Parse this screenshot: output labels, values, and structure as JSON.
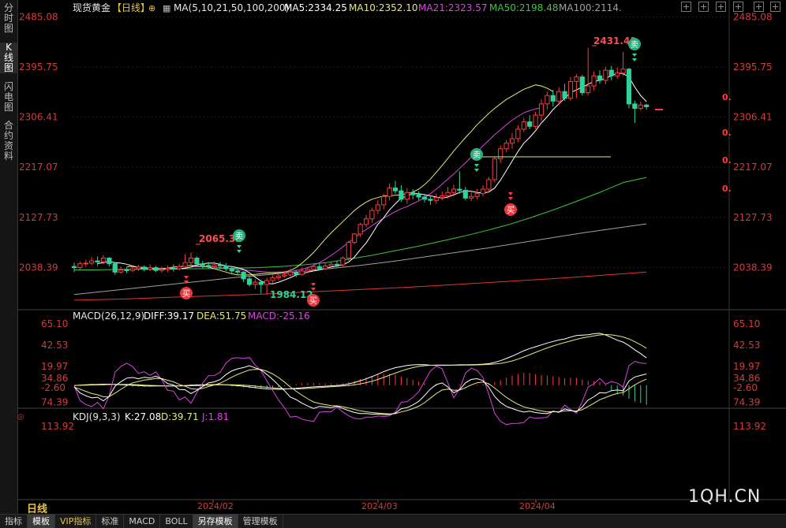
{
  "sidebar": {
    "tabs": [
      "分时图",
      "K线图",
      "闪电图",
      "合约资料"
    ],
    "active_index": 1
  },
  "header": {
    "name": "现货黄金",
    "period": "【日线】",
    "ma_label": "MA(5,10,21,50,100,200)",
    "ma5": "MA5:2334.25",
    "ma10": "MA10:2352.10",
    "ma21": "MA21:2323.57",
    "ma50": "MA50:2198.48",
    "ma100": "MA100:2114."
  },
  "macd_header": {
    "name": "MACD(26,12,9)",
    "diff": "DIFF:39.17",
    "dea": "DEA:51.75",
    "macd": "MACD:-25.16"
  },
  "kdj_header": {
    "name": "KDJ(9,3,3)",
    "k": "K:27.08",
    "d": "D:39.71",
    "j": "J:1.81"
  },
  "price_axis": [
    "2485.08",
    "2395.75",
    "2306.41",
    "2217.07",
    "2127.73",
    "2038.39"
  ],
  "macd_axis": [
    "65.10",
    "42.53",
    "19.97",
    "-2.60"
  ],
  "kdj_axis": [
    "113.92",
    "74.39",
    "34.86"
  ],
  "x_axis": [
    "2024/02",
    "2024/03",
    "2024/04"
  ],
  "annotations": {
    "high1": "2065.32",
    "low1": "1984.12",
    "high2": "2431.41",
    "buy": "买",
    "sell": "卖",
    "right_marks": [
      "0.",
      "0.",
      "0.",
      "0."
    ]
  },
  "bottom": {
    "period_button": "日线",
    "tabs": [
      "指标",
      "模板",
      "VIP指标",
      "标准",
      "MACD",
      "BOLL",
      "另存模板",
      "管理模板"
    ]
  },
  "watermark": "1QH.CN",
  "colors": {
    "up": "#ff3b3b",
    "down": "#2dd39a",
    "ma5": "#ffffff",
    "ma10": "#e8e87a",
    "ma21": "#d845e0",
    "ma50": "#3ec43e",
    "ma100": "#a0a0a0",
    "ma200": "#e03a2a"
  },
  "chart_data": {
    "type": "candlestick",
    "ylim": [
      1970,
      2490
    ],
    "candles": [
      [
        2040,
        2038,
        2047,
        2030
      ],
      [
        2038,
        2045,
        2049,
        2033
      ],
      [
        2045,
        2046,
        2052,
        2040
      ],
      [
        2046,
        2050,
        2057,
        2042
      ],
      [
        2050,
        2048,
        2058,
        2041
      ],
      [
        2048,
        2055,
        2060,
        2044
      ],
      [
        2055,
        2045,
        2057,
        2040
      ],
      [
        2045,
        2030,
        2047,
        2025
      ],
      [
        2030,
        2034,
        2040,
        2027
      ],
      [
        2034,
        2033,
        2039,
        2028
      ],
      [
        2033,
        2036,
        2041,
        2030
      ],
      [
        2036,
        2039,
        2043,
        2032
      ],
      [
        2039,
        2035,
        2042,
        2031
      ],
      [
        2035,
        2038,
        2044,
        2032
      ],
      [
        2038,
        2033,
        2041,
        2030
      ],
      [
        2033,
        2035,
        2040,
        2029
      ],
      [
        2035,
        2037,
        2042,
        2030
      ],
      [
        2037,
        2036,
        2044,
        2031
      ],
      [
        2036,
        2040,
        2045,
        2033
      ],
      [
        2040,
        2047,
        2062,
        2038
      ],
      [
        2047,
        2055,
        2065,
        2043
      ],
      [
        2055,
        2045,
        2058,
        2040
      ],
      [
        2045,
        2042,
        2050,
        2037
      ],
      [
        2042,
        2040,
        2048,
        2036
      ],
      [
        2040,
        2043,
        2049,
        2037
      ],
      [
        2043,
        2041,
        2048,
        2035
      ],
      [
        2041,
        2036,
        2046,
        2032
      ],
      [
        2036,
        2032,
        2041,
        2028
      ],
      [
        2032,
        2030,
        2038,
        2025
      ],
      [
        2030,
        2018,
        2032,
        2012
      ],
      [
        2018,
        2008,
        2022,
        2004
      ],
      [
        2008,
        2012,
        2017,
        2000
      ],
      [
        2012,
        2008,
        2016,
        1992
      ],
      [
        2008,
        2015,
        2020,
        1990
      ],
      [
        2015,
        2020,
        2025,
        2010
      ],
      [
        2020,
        2023,
        2028,
        2015
      ],
      [
        2023,
        2025,
        2032,
        2020
      ],
      [
        2025,
        2030,
        2036,
        2022
      ],
      [
        2030,
        2026,
        2034,
        2021
      ],
      [
        2026,
        2032,
        2038,
        2024
      ],
      [
        2032,
        2035,
        2040,
        2028
      ],
      [
        2035,
        2040,
        2044,
        2031
      ],
      [
        2040,
        2036,
        2045,
        2033
      ],
      [
        2036,
        2041,
        2046,
        2034
      ],
      [
        2041,
        2044,
        2048,
        2037
      ],
      [
        2044,
        2043,
        2050,
        2039
      ],
      [
        2043,
        2055,
        2058,
        2040
      ],
      [
        2055,
        2083,
        2086,
        2050
      ],
      [
        2083,
        2098,
        2100,
        2080
      ],
      [
        2098,
        2115,
        2118,
        2093
      ],
      [
        2115,
        2125,
        2132,
        2110
      ],
      [
        2125,
        2140,
        2145,
        2118
      ],
      [
        2140,
        2150,
        2158,
        2134
      ],
      [
        2150,
        2165,
        2170,
        2142
      ],
      [
        2165,
        2180,
        2188,
        2158
      ],
      [
        2180,
        2175,
        2193,
        2170
      ],
      [
        2175,
        2160,
        2185,
        2155
      ],
      [
        2160,
        2172,
        2180,
        2152
      ],
      [
        2172,
        2168,
        2178,
        2160
      ],
      [
        2168,
        2164,
        2174,
        2158
      ],
      [
        2164,
        2160,
        2170,
        2154
      ],
      [
        2160,
        2158,
        2167,
        2150
      ],
      [
        2158,
        2163,
        2170,
        2152
      ],
      [
        2163,
        2166,
        2174,
        2158
      ],
      [
        2166,
        2172,
        2182,
        2161
      ],
      [
        2172,
        2178,
        2186,
        2165
      ],
      [
        2178,
        2176,
        2210,
        2170
      ],
      [
        2176,
        2162,
        2182,
        2158
      ],
      [
        2162,
        2165,
        2172,
        2157
      ],
      [
        2165,
        2170,
        2178,
        2160
      ],
      [
        2170,
        2178,
        2185,
        2165
      ],
      [
        2178,
        2195,
        2200,
        2172
      ],
      [
        2195,
        2232,
        2236,
        2190
      ],
      [
        2232,
        2250,
        2256,
        2225
      ],
      [
        2250,
        2260,
        2266,
        2244
      ],
      [
        2260,
        2268,
        2278,
        2250
      ],
      [
        2268,
        2285,
        2292,
        2262
      ],
      [
        2285,
        2298,
        2305,
        2280
      ],
      [
        2298,
        2290,
        2310,
        2285
      ],
      [
        2290,
        2310,
        2316,
        2285
      ],
      [
        2310,
        2330,
        2338,
        2300
      ],
      [
        2330,
        2345,
        2352,
        2320
      ],
      [
        2345,
        2335,
        2355,
        2325
      ],
      [
        2335,
        2352,
        2360,
        2328
      ],
      [
        2352,
        2340,
        2366,
        2335
      ],
      [
        2340,
        2370,
        2378,
        2336
      ],
      [
        2370,
        2378,
        2383,
        2340
      ],
      [
        2378,
        2350,
        2382,
        2345
      ],
      [
        2350,
        2362,
        2430,
        2345
      ],
      [
        2362,
        2380,
        2388,
        2354
      ],
      [
        2380,
        2372,
        2390,
        2366
      ],
      [
        2372,
        2390,
        2396,
        2365
      ],
      [
        2390,
        2380,
        2398,
        2372
      ],
      [
        2380,
        2385,
        2395,
        2375
      ],
      [
        2385,
        2392,
        2423,
        2380
      ],
      [
        2392,
        2330,
        2394,
        2322
      ],
      [
        2330,
        2322,
        2336,
        2296
      ],
      [
        2322,
        2328,
        2334,
        2318
      ],
      [
        2328,
        2325,
        2330,
        2320
      ]
    ],
    "ma": {
      "ma5": {
        "start": 4,
        "points": [
          2045,
          2047,
          2049,
          2047,
          2046,
          2044,
          2041,
          2038,
          2036,
          2035,
          2036,
          2036,
          2036,
          2036,
          2036,
          2037,
          2039,
          2043,
          2045,
          2046,
          2046,
          2044,
          2041,
          2040,
          2038,
          2035,
          2029,
          2021,
          2014,
          2010,
          2009,
          2012,
          2016,
          2020,
          2025,
          2027,
          2030,
          2032,
          2034,
          2037,
          2039,
          2041,
          2043,
          2048,
          2057,
          2070,
          2082,
          2098,
          2115,
          2127,
          2141,
          2152,
          2162,
          2166,
          2170,
          2170,
          2168,
          2166,
          2164,
          2162,
          2164,
          2168,
          2172,
          2175,
          2174,
          2172,
          2171,
          2173,
          2180,
          2194,
          2211,
          2228,
          2245,
          2260,
          2270,
          2282,
          2296,
          2307,
          2320,
          2330,
          2340,
          2350,
          2355,
          2360,
          2365,
          2370,
          2372,
          2376,
          2380,
          2385,
          2384,
          2378,
          2360,
          2345,
          2334
        ]
      },
      "ma10": {
        "start": 9,
        "points": [
          2040,
          2040,
          2039,
          2038,
          2037,
          2036,
          2036,
          2037,
          2039,
          2040,
          2041,
          2042,
          2041,
          2040,
          2039,
          2036,
          2033,
          2030,
          2027,
          2025,
          2025,
          2025,
          2026,
          2027,
          2028,
          2028,
          2029,
          2030,
          2033,
          2038,
          2046,
          2055,
          2065,
          2077,
          2089,
          2100,
          2110,
          2120,
          2130,
          2140,
          2148,
          2155,
          2160,
          2163,
          2166,
          2166,
          2167,
          2168,
          2170,
          2173,
          2178,
          2186,
          2196,
          2208,
          2220,
          2233,
          2246,
          2258,
          2270,
          2281,
          2293,
          2303,
          2313,
          2322,
          2330,
          2338,
          2344,
          2350,
          2356,
          2360,
          2364,
          2362,
          2358,
          2352
        ]
      },
      "ma21": {
        "start": 20,
        "points": [
          2040,
          2040,
          2040,
          2040,
          2039,
          2038,
          2037,
          2036,
          2035,
          2034,
          2033,
          2032,
          2031,
          2030,
          2030,
          2030,
          2030,
          2031,
          2033,
          2035,
          2038,
          2042,
          2047,
          2053,
          2060,
          2067,
          2075,
          2083,
          2091,
          2099,
          2106,
          2113,
          2120,
          2126,
          2132,
          2138,
          2143,
          2147,
          2152,
          2157,
          2163,
          2170,
          2178,
          2187,
          2196,
          2205,
          2215,
          2225,
          2235,
          2245,
          2255,
          2265,
          2275,
          2284,
          2293,
          2301,
          2308,
          2314,
          2318,
          2321,
          2323
        ]
      },
      "ma50": {
        "start": 0,
        "points": [
          2034,
          2034,
          2035,
          2035,
          2035,
          2036,
          2036,
          2037,
          2038,
          2040,
          2043,
          2047,
          2053,
          2060,
          2068,
          2076,
          2085,
          2094,
          2104,
          2115,
          2128,
          2142,
          2157,
          2173,
          2190,
          2199
        ]
      },
      "ma100": {
        "start": 0,
        "points": [
          1990,
          1996,
          2002,
          2008,
          2014,
          2020,
          2025,
          2030,
          2036,
          2042,
          2049,
          2057,
          2065,
          2073,
          2082,
          2091,
          2100,
          2108,
          2116
        ]
      },
      "ma200": {
        "start": 0,
        "points": [
          1980,
          1982,
          1985,
          1988,
          1991,
          1995,
          1999,
          2003,
          2008,
          2013,
          2018,
          2024,
          2030
        ]
      }
    }
  }
}
